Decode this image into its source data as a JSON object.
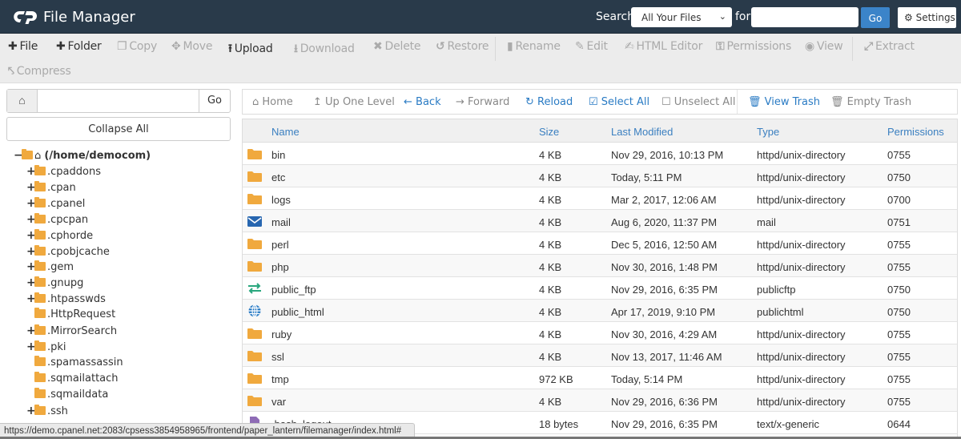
{
  "header": {
    "app_title": "File Manager",
    "search_label": "Search",
    "search_scope": "All Your Files",
    "for_label": "for",
    "search_value": "",
    "go_label": "Go",
    "settings_label": "Settings"
  },
  "toolbar": {
    "items": [
      {
        "label": "File",
        "icon": "plus-icon",
        "enabled": true
      },
      {
        "label": "Folder",
        "icon": "plus-icon",
        "enabled": true
      },
      {
        "label": "Copy",
        "icon": "copy-icon",
        "enabled": false
      },
      {
        "label": "Move",
        "icon": "move-icon",
        "enabled": false
      },
      {
        "label": "Upload",
        "icon": "upload-icon",
        "enabled": true
      },
      {
        "label": "Download",
        "icon": "download-icon",
        "enabled": false
      },
      {
        "label": "Delete",
        "icon": "delete-icon",
        "enabled": false
      },
      {
        "label": "Restore",
        "icon": "restore-icon",
        "enabled": false
      },
      {
        "label": "Rename",
        "icon": "file-icon",
        "enabled": false
      },
      {
        "label": "Edit",
        "icon": "pencil-icon",
        "enabled": false
      },
      {
        "label": "HTML Editor",
        "icon": "edit-box-icon",
        "enabled": false
      },
      {
        "label": "Permissions",
        "icon": "key-icon",
        "enabled": false
      },
      {
        "label": "View",
        "icon": "eye-icon",
        "enabled": false
      },
      {
        "label": "Extract",
        "icon": "expand-icon",
        "enabled": false
      },
      {
        "label": "Compress",
        "icon": "compress-icon",
        "enabled": false
      }
    ]
  },
  "left_panel": {
    "path_value": "",
    "go_label": "Go",
    "collapse_label": "Collapse All",
    "root_label": "(/home/democom)",
    "tree": [
      {
        "name": ".cpaddons",
        "expandable": true
      },
      {
        "name": ".cpan",
        "expandable": true
      },
      {
        "name": ".cpanel",
        "expandable": true
      },
      {
        "name": ".cpcpan",
        "expandable": true
      },
      {
        "name": ".cphorde",
        "expandable": true
      },
      {
        "name": ".cpobjcache",
        "expandable": true
      },
      {
        "name": ".gem",
        "expandable": true
      },
      {
        "name": ".gnupg",
        "expandable": true
      },
      {
        "name": ".htpasswds",
        "expandable": true
      },
      {
        "name": ".HttpRequest",
        "expandable": false
      },
      {
        "name": ".MirrorSearch",
        "expandable": true
      },
      {
        "name": ".pki",
        "expandable": true
      },
      {
        "name": ".spamassassin",
        "expandable": false
      },
      {
        "name": ".sqmailattach",
        "expandable": false
      },
      {
        "name": ".sqmaildata",
        "expandable": false
      },
      {
        "name": ".ssh",
        "expandable": true
      }
    ]
  },
  "nav": {
    "home": "Home",
    "up": "Up One Level",
    "back": "Back",
    "forward": "Forward",
    "reload": "Reload",
    "select_all": "Select All",
    "unselect_all": "Unselect All",
    "view_trash": "View Trash",
    "empty_trash": "Empty Trash"
  },
  "table": {
    "columns": [
      "Name",
      "Size",
      "Last Modified",
      "Type",
      "Permissions"
    ],
    "rows": [
      {
        "icon": "folder",
        "name": "bin",
        "size": "4 KB",
        "modified": "Nov 29, 2016, 10:13 PM",
        "type": "httpd/unix-directory",
        "perms": "0755"
      },
      {
        "icon": "folder",
        "name": "etc",
        "size": "4 KB",
        "modified": "Today, 5:11 PM",
        "type": "httpd/unix-directory",
        "perms": "0750"
      },
      {
        "icon": "folder",
        "name": "logs",
        "size": "4 KB",
        "modified": "Mar 2, 2017, 12:06 AM",
        "type": "httpd/unix-directory",
        "perms": "0700"
      },
      {
        "icon": "mail",
        "name": "mail",
        "size": "4 KB",
        "modified": "Aug 6, 2020, 11:37 PM",
        "type": "mail",
        "perms": "0751"
      },
      {
        "icon": "folder",
        "name": "perl",
        "size": "4 KB",
        "modified": "Dec 5, 2016, 12:50 AM",
        "type": "httpd/unix-directory",
        "perms": "0755"
      },
      {
        "icon": "folder",
        "name": "php",
        "size": "4 KB",
        "modified": "Nov 30, 2016, 1:48 PM",
        "type": "httpd/unix-directory",
        "perms": "0755"
      },
      {
        "icon": "ftp",
        "name": "public_ftp",
        "size": "4 KB",
        "modified": "Nov 29, 2016, 6:35 PM",
        "type": "publicftp",
        "perms": "0750"
      },
      {
        "icon": "globe",
        "name": "public_html",
        "size": "4 KB",
        "modified": "Apr 17, 2019, 9:10 PM",
        "type": "publichtml",
        "perms": "0750"
      },
      {
        "icon": "folder",
        "name": "ruby",
        "size": "4 KB",
        "modified": "Nov 30, 2016, 4:29 AM",
        "type": "httpd/unix-directory",
        "perms": "0755"
      },
      {
        "icon": "folder",
        "name": "ssl",
        "size": "4 KB",
        "modified": "Nov 13, 2017, 11:46 AM",
        "type": "httpd/unix-directory",
        "perms": "0755"
      },
      {
        "icon": "folder",
        "name": "tmp",
        "size": "972 KB",
        "modified": "Today, 5:14 PM",
        "type": "httpd/unix-directory",
        "perms": "0755"
      },
      {
        "icon": "folder",
        "name": "var",
        "size": "4 KB",
        "modified": "Nov 29, 2016, 6:36 PM",
        "type": "httpd/unix-directory",
        "perms": "0755"
      },
      {
        "icon": "file",
        "name": ".bash_logout",
        "size": "18 bytes",
        "modified": "Nov 29, 2016, 6:35 PM",
        "type": "text/x-generic",
        "perms": "0644"
      }
    ]
  },
  "status_url": "https://demo.cpanel.net:2083/cpsess3854958965/frontend/paper_lantern/filemanager/index.html#",
  "colors": {
    "header_bg": "#293a4a",
    "accent_blue": "#3b84c9",
    "folder": "#f0a93e",
    "link_blue": "#2a7bc4"
  }
}
